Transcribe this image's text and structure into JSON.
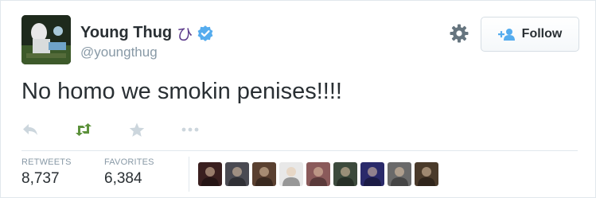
{
  "user": {
    "display_name": "Young Thug",
    "name_glyph": "ひ",
    "handle": "@youngthug",
    "verified": true,
    "avatar_icon": "avatar-photo"
  },
  "header": {
    "settings_icon": "gear-icon",
    "follow_label": "Follow",
    "follow_icon": "add-user-icon"
  },
  "tweet": {
    "text": "No homo we smokin penises!!!!"
  },
  "actions": [
    {
      "name": "reply",
      "icon": "reply-icon"
    },
    {
      "name": "retweet",
      "icon": "retweet-icon",
      "color": "#5c913b"
    },
    {
      "name": "favorite",
      "icon": "star-icon"
    },
    {
      "name": "more",
      "icon": "more-icon"
    }
  ],
  "stats": {
    "retweets_label": "RETWEETS",
    "retweets_value": "8,737",
    "favorites_label": "FAVORITES",
    "favorites_value": "6,384"
  },
  "favorited_by": [
    {
      "color": "#3a1f1f"
    },
    {
      "color": "#4a4a52"
    },
    {
      "color": "#5a4030"
    },
    {
      "color": "#e8e8e8"
    },
    {
      "color": "#8a5a5a"
    },
    {
      "color": "#3c4a3c"
    },
    {
      "color": "#2a2a6a"
    },
    {
      "color": "#6a6a6a"
    },
    {
      "color": "#4a3a2a"
    }
  ],
  "colors": {
    "accent": "#55acee",
    "text": "#292f33",
    "muted": "#8899a6",
    "retweet_green": "#5c913b"
  }
}
